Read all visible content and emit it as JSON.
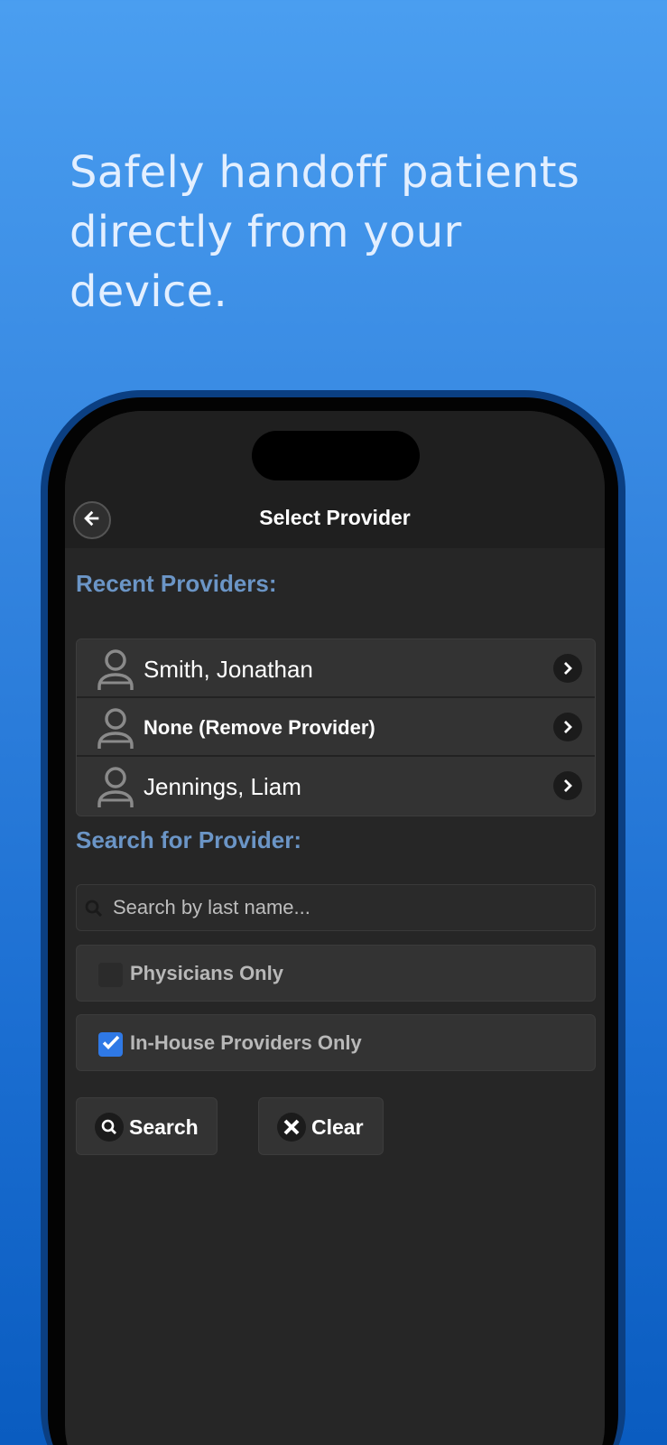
{
  "headline": "Safely handoff patients directly from your device.",
  "header": {
    "title": "Select Provider"
  },
  "recent": {
    "label": "Recent Providers:",
    "items": [
      {
        "name": "Smith, Jonathan"
      },
      {
        "name": "None (Remove Provider)"
      },
      {
        "name": "Jennings, Liam"
      }
    ]
  },
  "search": {
    "label": "Search for Provider:",
    "placeholder": "Search by last name..."
  },
  "filters": {
    "physicians_only": {
      "label": "Physicians Only",
      "checked": false
    },
    "in_house_only": {
      "label": "In-House Providers Only",
      "checked": true
    }
  },
  "buttons": {
    "search": "Search",
    "clear": "Clear"
  },
  "icons": {
    "back": "arrow-left-icon",
    "avatar": "person-icon",
    "chevron": "chevron-right-icon",
    "search": "search-icon",
    "clear": "x-icon",
    "check": "check-icon"
  },
  "colors": {
    "background_top": "#4a9ef0",
    "background_bottom": "#0a5cc0",
    "section_label": "#6b95c6",
    "checkbox_on": "#2f79e6"
  }
}
